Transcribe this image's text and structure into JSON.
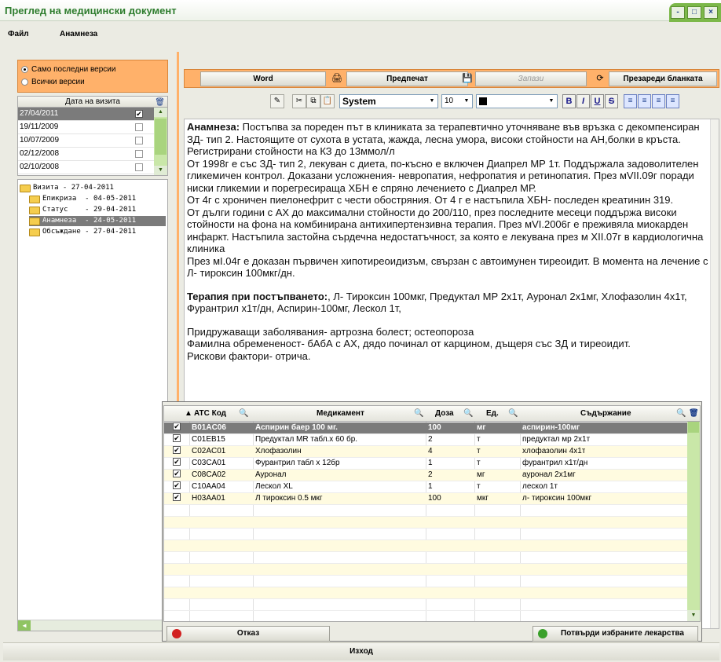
{
  "window": {
    "title": "Преглед на медицински документ"
  },
  "menu": {
    "file": "Файл",
    "anamnesis": "Анамнеза"
  },
  "versions": {
    "latest_only": "Само последни версии",
    "all": "Всички версии"
  },
  "visits": {
    "header": "Дата на визита",
    "rows": [
      {
        "date": "27/04/2011",
        "checked": "✔"
      },
      {
        "date": "19/11/2009",
        "checked": ""
      },
      {
        "date": "10/07/2009",
        "checked": ""
      },
      {
        "date": "02/12/2008",
        "checked": ""
      },
      {
        "date": "02/10/2008",
        "checked": ""
      }
    ]
  },
  "tree": {
    "root": "Визита - 27-04-2011",
    "children": [
      {
        "name": "Епикриза  - 04-05-2011"
      },
      {
        "name": "Статус    - 29-04-2011"
      },
      {
        "name": "Анамнеза  - 24-05-2011"
      },
      {
        "name": "Обсъждане - 27-04-2011"
      }
    ]
  },
  "toolbar": {
    "word": "Word",
    "preview": "Предпечат",
    "save": "Запази",
    "reload": "Презареди бланката"
  },
  "format": {
    "font": "System",
    "size": "10",
    "bold": "B",
    "italic": "I",
    "underline": "U",
    "strike": "S"
  },
  "document": {
    "p1_label": "Анамнеза:",
    "p1": " Постъпва за пореден път в клиниката  за терапевтично уточняване във връзка с декомпенсиран ЗД- тип 2. Настоящите  от сухота в устата, жажда, лесна умора, високи стойности на АН,болки в кръста. Регистрирани стойности на КЗ до 13ммол/л",
    "p2": "От 1998г е със ЗД- тип 2, лекуван с диета, по-късно е включен Диапрел МР 1т. Поддържала задоволителен гликемичен контрол. Доказани усложнения- невропатия, нефропатия и ретинопатия. През мVII.09г поради ниски гликемии и порегресираща ХБН е спряно лечението с Диапрел МР.",
    "p3": " От 4г с хроничен пиелонефрит с чести обостряния. От 4 г е настъпила  ХБН- последен креатинин 319.",
    "p4": " От дълги години с АХ до максимални стойности до 200/110, през последните месеци  поддържа високи стойности на фона на комбинирана антихипертензивна терапия.  През мVI.2006г е преживяла миокарден инфаркт. Настъпила застойна сърдечна недостатъчност, за която е лекувана през м XII.07г в кардиологична клиника",
    "p5": "През мI.04г е доказан първичен хипотиреоидизъм, свързан с автоимунен тиреоидит. В момента на лечение с Л- тироксин 100мкг/дн.",
    "p6_label": "Терапия при постъпването:",
    "p6": ", Л- Тироксин 100мкг, Предуктал МР 2х1т, Ауронал 2х1мг, Хлофазолин 4х1т, Фурантрил х1т/дн, Аспирин-100мг, Лескол 1т,",
    "p7": " Придружаващи заболявания-  артрозна болест; остеопороза",
    "p8": "Фамилна обремененост- бАбА с АХ, дядо починал от карцином, дъщеря със ЗД и тиреоидит.",
    "p9": "Рискови фактори- отрича."
  },
  "meds": {
    "headers": {
      "atc": "ATC Код",
      "name": "Медикамент",
      "dose": "Доза",
      "unit": "Ед.",
      "content": "Съдържание"
    },
    "rows": [
      {
        "check": "✔",
        "atc": "B01AC06",
        "name": "Аспирин баер 100 мг.",
        "dose": "100",
        "unit": "мг",
        "content": "аспирин-100мг"
      },
      {
        "check": "✔",
        "atc": "C01EB15",
        "name": "Предуктал MR табл.х 60 бр.",
        "dose": "2",
        "unit": "т",
        "content": "предуктал мр 2х1т"
      },
      {
        "check": "✔",
        "atc": "C02AC01",
        "name": "Хлофазолин",
        "dose": "4",
        "unit": "т",
        "content": "хлофазолин 4х1т"
      },
      {
        "check": "✔",
        "atc": "C03CA01",
        "name": "Фурантрил табл х 12бр",
        "dose": "1",
        "unit": "т",
        "content": "фурантрил х1т/дн"
      },
      {
        "check": "✔",
        "atc": "C08CA02",
        "name": "Ауронал",
        "dose": "2",
        "unit": "мг",
        "content": "ауронал 2х1мг"
      },
      {
        "check": "✔",
        "atc": "C10AA04",
        "name": "Лескол XL",
        "dose": "1",
        "unit": "т",
        "content": "лескол 1т"
      },
      {
        "check": "✔",
        "atc": "H03AA01",
        "name": "Л тироксин 0.5 мкг",
        "dose": "100",
        "unit": "мкг",
        "content": "л- тироксин 100мкг"
      }
    ],
    "cancel": "Отказ",
    "confirm": "Потвърди избраните лекарства"
  },
  "footer": {
    "exit": "Изход"
  },
  "colors": {
    "accent": "#ffb16a",
    "title_green": "#2e7d2e",
    "selected_row": "#7b7b7b",
    "scroll_green": "#c9e7a8"
  }
}
